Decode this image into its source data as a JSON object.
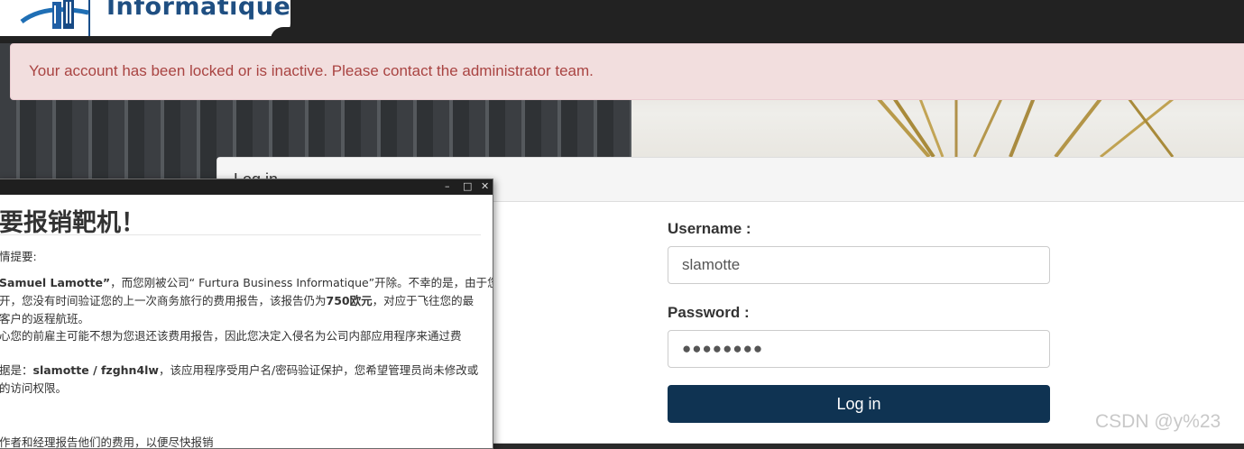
{
  "header": {
    "logo_text": "Informatique"
  },
  "alert": {
    "message": "Your account has been locked or is inactive. Please contact the administrator team."
  },
  "login": {
    "title": "Log in",
    "username_label": "Username :",
    "username_value": "slamotte",
    "password_label": "Password :",
    "password_value": "●●●●●●●●",
    "submit_label": "Log in"
  },
  "popup": {
    "controls": [
      "–",
      "□",
      "✕"
    ],
    "heading": "要报销靶机！",
    "line1": "情提要:",
    "line2_a": "Samuel Lamotte”",
    "line2_b": "，而您刚被公司“ Furtura Business Informatique”开除。不幸的是，由于您",
    "line3_a": "开，您没有时间验证您的上一次商务旅行的费用报告，该报告仍为",
    "line3_b": "750欧元",
    "line3_c": "，对应于飞往您的最",
    "line4": "客户的返程航班。",
    "line5": "心您的前雇主可能不想为您退还该费用报告，因此您决定入侵名为公司内部应用程序来通过费",
    "line6_a": "据是：",
    "line6_b": "slamotte / fzghn4lw",
    "line6_c": "，该应用程序受用户名/密码验证保护，您希望管理员尚未修改或",
    "line7": "的访问权限。",
    "line8": "作者和经理报告他们的费用，以便尽快报销"
  },
  "watermark": "CSDN @y%23"
}
